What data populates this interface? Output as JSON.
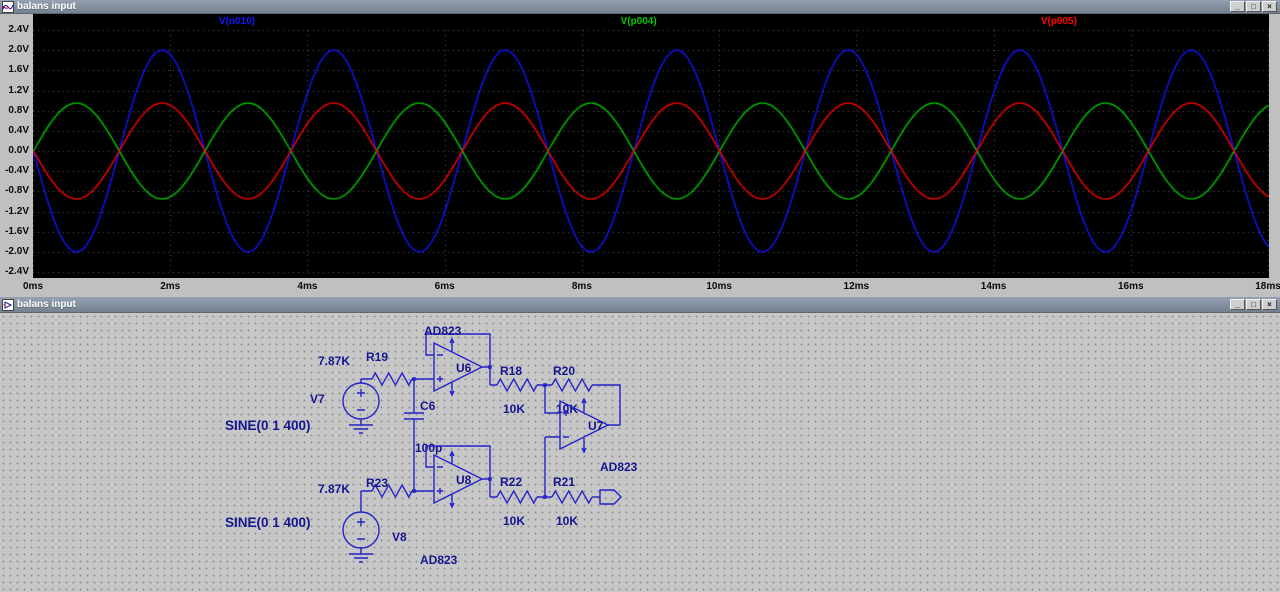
{
  "windows": {
    "plot_window": {
      "title": "balans input"
    },
    "schematic_window": {
      "title": "balans input"
    }
  },
  "window_controls": {
    "minimize": "_",
    "maximize": "□",
    "close": "×"
  },
  "chart_data": {
    "type": "line",
    "title": "",
    "background": "#000000",
    "grid": "dotted",
    "legend_position": "top-inside",
    "x_axis": {
      "unit": "ms",
      "min": 0,
      "max": 18,
      "tick_step": 2,
      "labels": [
        "0ms",
        "2ms",
        "4ms",
        "6ms",
        "8ms",
        "10ms",
        "12ms",
        "14ms",
        "16ms",
        "18ms"
      ]
    },
    "y_axis": {
      "unit": "V",
      "min": -2.4,
      "max": 2.4,
      "tick_step": 0.4,
      "labels": [
        "2.4V",
        "2.0V",
        "1.6V",
        "1.2V",
        "0.8V",
        "0.4V",
        "0.0V",
        "-0.4V",
        "-0.8V",
        "-1.2V",
        "-1.6V",
        "-2.0V",
        "-2.4V"
      ]
    },
    "series": [
      {
        "name": "V(n010)",
        "color": "#1414ff",
        "waveform": "sine",
        "amplitude_v": 2.0,
        "frequency_hz": 400,
        "phase_deg": 180,
        "offset_v": 0
      },
      {
        "name": "V(p004)",
        "color": "#00c800",
        "waveform": "sine",
        "amplitude_v": 0.95,
        "frequency_hz": 400,
        "phase_deg": 0,
        "offset_v": 0
      },
      {
        "name": "V(p005)",
        "color": "#ff0000",
        "waveform": "sine",
        "amplitude_v": 0.95,
        "frequency_hz": 400,
        "phase_deg": 180,
        "offset_v": 0
      }
    ]
  },
  "schematic": {
    "components": {
      "u6": {
        "ref": "U6",
        "part": "AD823"
      },
      "u7": {
        "ref": "U7",
        "part": "AD823"
      },
      "u8": {
        "ref": "U8",
        "part": "AD823"
      },
      "r19": {
        "ref": "R19",
        "value": "7.87K"
      },
      "r18": {
        "ref": "R18",
        "value": "10K"
      },
      "r20": {
        "ref": "R20",
        "value": "10K"
      },
      "r23": {
        "ref": "R23",
        "value": "7.87K"
      },
      "r22": {
        "ref": "R22",
        "value": "10K"
      },
      "r21": {
        "ref": "R21",
        "value": "10K"
      },
      "c6": {
        "ref": "C6",
        "value": "100p"
      },
      "v7": {
        "ref": "V7",
        "value": "SINE(0 1 400)"
      },
      "v8": {
        "ref": "V8",
        "value": "SINE(0 1 400)"
      }
    }
  }
}
